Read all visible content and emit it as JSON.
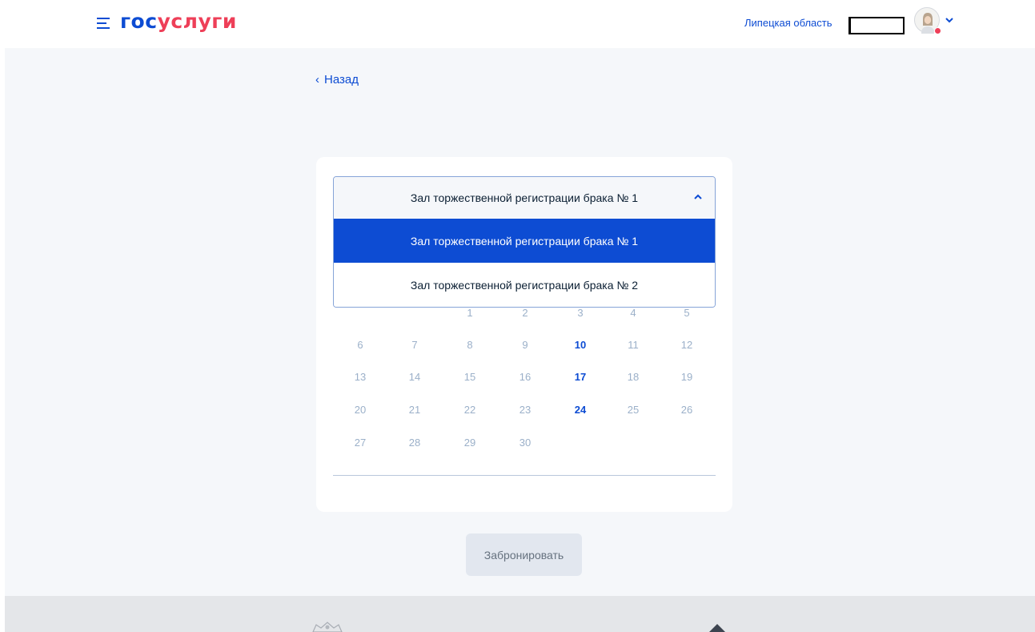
{
  "header": {
    "menu_icon": "burger-menu-icon",
    "logo_part1": "гос",
    "logo_part2": "услуги",
    "region": "Липецкая область",
    "user_name": "",
    "avatar_icon": "user-avatar-icon"
  },
  "nav": {
    "back_label": "Назад"
  },
  "hall_select": {
    "selected": "Зал торжественной регистрации брака № 1",
    "options": [
      "Зал торжественной регистрации брака № 1",
      "Зал торжественной регистрации брака № 2"
    ]
  },
  "calendar": {
    "days": [
      {
        "d": "1",
        "avail": false
      },
      {
        "d": "2",
        "avail": false
      },
      {
        "d": "3",
        "avail": false
      },
      {
        "d": "4",
        "avail": false
      },
      {
        "d": "5",
        "avail": false
      },
      {
        "d": "6",
        "avail": false
      },
      {
        "d": "7",
        "avail": false
      },
      {
        "d": "8",
        "avail": false
      },
      {
        "d": "9",
        "avail": false
      },
      {
        "d": "10",
        "avail": true
      },
      {
        "d": "11",
        "avail": false
      },
      {
        "d": "12",
        "avail": false
      },
      {
        "d": "13",
        "avail": false
      },
      {
        "d": "14",
        "avail": false
      },
      {
        "d": "15",
        "avail": false
      },
      {
        "d": "16",
        "avail": false
      },
      {
        "d": "17",
        "avail": true
      },
      {
        "d": "18",
        "avail": false
      },
      {
        "d": "19",
        "avail": false
      },
      {
        "d": "20",
        "avail": false
      },
      {
        "d": "21",
        "avail": false
      },
      {
        "d": "22",
        "avail": false
      },
      {
        "d": "23",
        "avail": false
      },
      {
        "d": "24",
        "avail": true
      },
      {
        "d": "25",
        "avail": false
      },
      {
        "d": "26",
        "avail": false
      },
      {
        "d": "27",
        "avail": false
      },
      {
        "d": "28",
        "avail": false
      },
      {
        "d": "29",
        "avail": false
      },
      {
        "d": "30",
        "avail": false
      }
    ]
  },
  "actions": {
    "book_label": "Забронировать"
  },
  "colors": {
    "brand_blue": "#0d4cd3",
    "brand_red": "#ee3f58",
    "page_bg": "#f5f7fa"
  }
}
